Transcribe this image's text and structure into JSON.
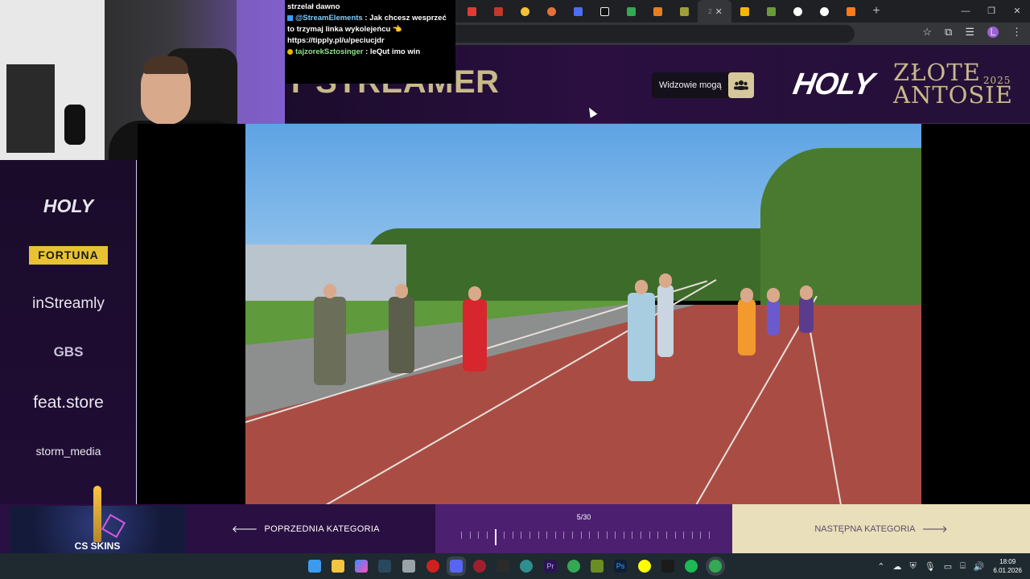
{
  "chat": {
    "line0": "strzelał dawno",
    "msg1_user": "@StreamElements",
    "msg1_text": " : Jak chcesz wesprzeć to trzymaj linka wykolejeńcu 👈",
    "msg1_link": "https://tipply.pl/u/peciucjdr",
    "msg2_user": "tajzorekSztosinger",
    "msg2_text": " : leQut imo win"
  },
  "browser": {
    "active_tab_number": "2"
  },
  "header": {
    "category_title": "Y STREAMER",
    "viewers_label": "Widzowie mogą",
    "brand_logo": "HOLY",
    "event_line1": "ZŁOTE",
    "event_year": "2025",
    "event_line2": "ANTOSIE"
  },
  "sponsors": {
    "holy": "HOLY",
    "fortuna": "FORTUNA",
    "instreamly": "inStreamly",
    "gbs": "GBS",
    "feat": "feat.store",
    "storm": "storm_media"
  },
  "nav": {
    "prev_label": "POPRZEDNIA KATEGORIA",
    "next_label": "NASTĘPNA KATEGORIA",
    "counter": "5/30",
    "current": 5,
    "total": 30
  },
  "promo": {
    "label": "CS SKINS"
  },
  "taskbar": {
    "time": "18:09",
    "date": "6.01.2026"
  },
  "colors": {
    "accent_gold": "#c8b98a",
    "header_purple": "#2a0f40",
    "next_button_bg": "#e9dfba",
    "progress_bg": "#4d1f70"
  }
}
